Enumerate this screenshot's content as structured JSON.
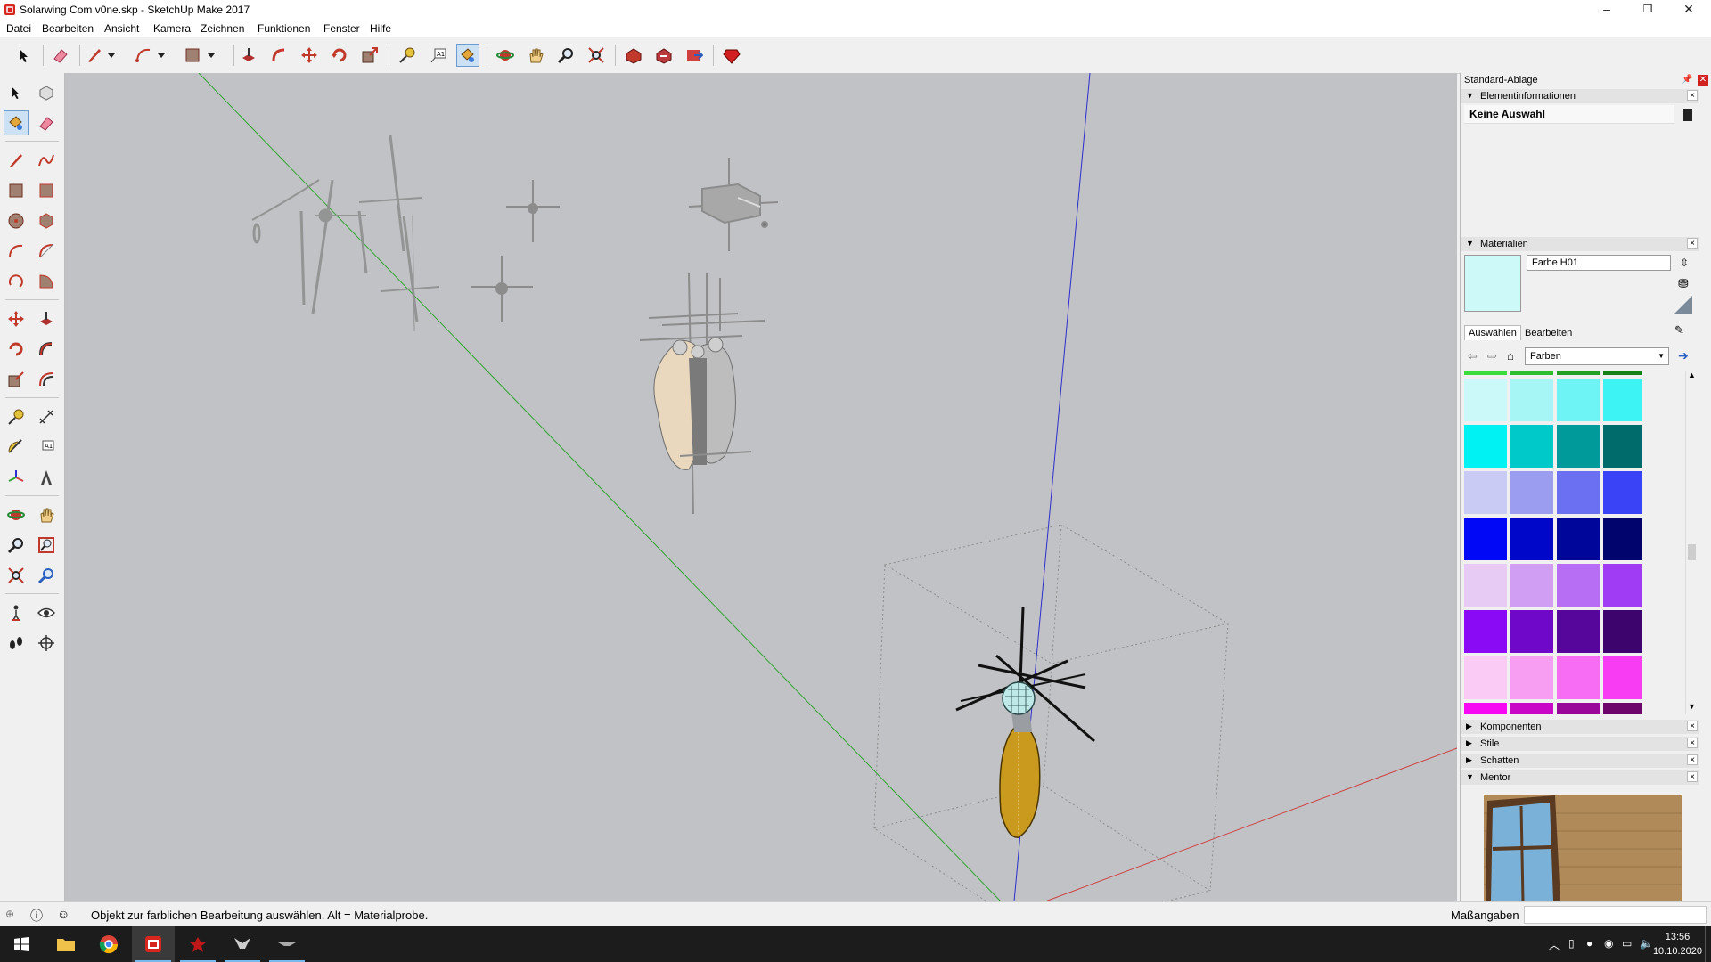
{
  "window": {
    "title": "Solarwing Com v0ne.skp - SketchUp Make 2017",
    "minimize": "–",
    "restore": "❐",
    "close": "✕"
  },
  "menu": [
    "Datei",
    "Bearbeiten",
    "Ansicht",
    "Kamera",
    "Zeichnen",
    "Funktionen",
    "Fenster",
    "Hilfe"
  ],
  "tray": {
    "title": "Standard-Ablage",
    "element_info": {
      "header": "Elementinformationen",
      "selection": "Keine Auswahl"
    },
    "materials": {
      "header": "Materialien",
      "material_name": "Farbe H01",
      "preview_color": "#cdfaf9",
      "tabs": [
        "Auswählen",
        "Bearbeiten"
      ],
      "collection": "Farben",
      "swatch_rows": [
        [
          "#cbf9f9",
          "#a6f6f6",
          "#6ef4f4",
          "#3ef3f3"
        ],
        [
          "#00f2f2",
          "#00c9c9",
          "#009a9a",
          "#006b6b"
        ],
        [
          "#cacbf5",
          "#9b9ef0",
          "#6b70f3",
          "#3a44f6"
        ],
        [
          "#0008f5",
          "#0007c8",
          "#00069a",
          "#00046c"
        ],
        [
          "#e7cbf5",
          "#d09ef2",
          "#b86df5",
          "#a13cf5"
        ],
        [
          "#8a0af6",
          "#7008c9",
          "#56069b",
          "#3c046c"
        ],
        [
          "#f9cbf5",
          "#f89ef2",
          "#f76df4",
          "#f73cf3"
        ]
      ],
      "top_strip": [
        "#3bdc3b",
        "#2fbe2f",
        "#239f23",
        "#178017"
      ],
      "bottom_strip": [
        "#f70af3",
        "#c908c7",
        "#9b069a",
        "#6c046c"
      ]
    },
    "collapsed_panels": [
      "Komponenten",
      "Stile",
      "Schatten"
    ],
    "mentor": {
      "header": "Mentor"
    }
  },
  "status": {
    "message": "Objekt zur farblichen Bearbeitung auswählen. Alt = Materialprobe.",
    "measurements_label": "Maßangaben",
    "measurements_value": ""
  },
  "taskbar": {
    "time": "13:56",
    "date": "10.10.2020"
  },
  "colors": {
    "viewport_bg": "#c0c2c5",
    "axis_green": "#2fa52f",
    "axis_blue": "#2d2dd0",
    "axis_red": "#d04040",
    "wing_yellow": "#c99a1e",
    "accent_selected": "#cde1f5"
  }
}
